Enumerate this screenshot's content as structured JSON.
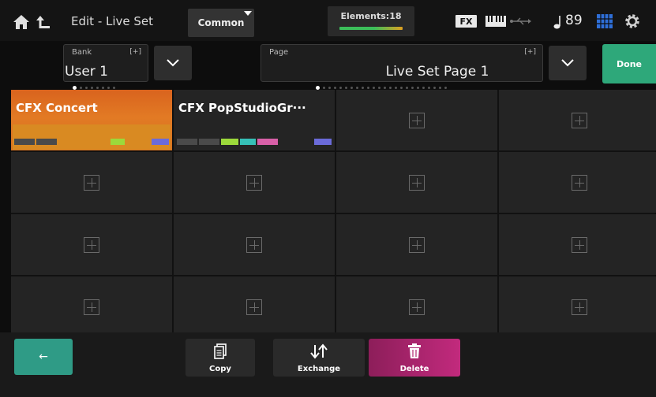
{
  "header": {
    "title": "Edit - Live Set",
    "common_label": "Common",
    "elements_label": "Elements:18",
    "fx_label": "FX",
    "tempo": "89",
    "icons": [
      "home-icon",
      "up-level-icon",
      "keyboard-icon",
      "usb-icon",
      "note-icon",
      "grid-icon",
      "gear-icon"
    ]
  },
  "selector": {
    "bank_caption": "Bank",
    "bank_tag": "[+]",
    "bank_value": "User 1",
    "page_caption": "Page",
    "page_tag": "[+]",
    "page_value": "Live Set Page  1",
    "done_label": "Done"
  },
  "slots": [
    {
      "name": "CFX Concert",
      "selected": true
    },
    {
      "name": "CFX PopStudioGr···",
      "selected": false
    }
  ],
  "empty_slot_count": 14,
  "toolbar": {
    "back_label": "←",
    "copy_label": "Copy",
    "exchange_label": "Exchange",
    "delete_label": "Delete"
  },
  "colors": {
    "selected_slot": "#d9631e",
    "done": "#2ea87a",
    "back": "#2f9b86",
    "delete": "#c22a7d"
  }
}
